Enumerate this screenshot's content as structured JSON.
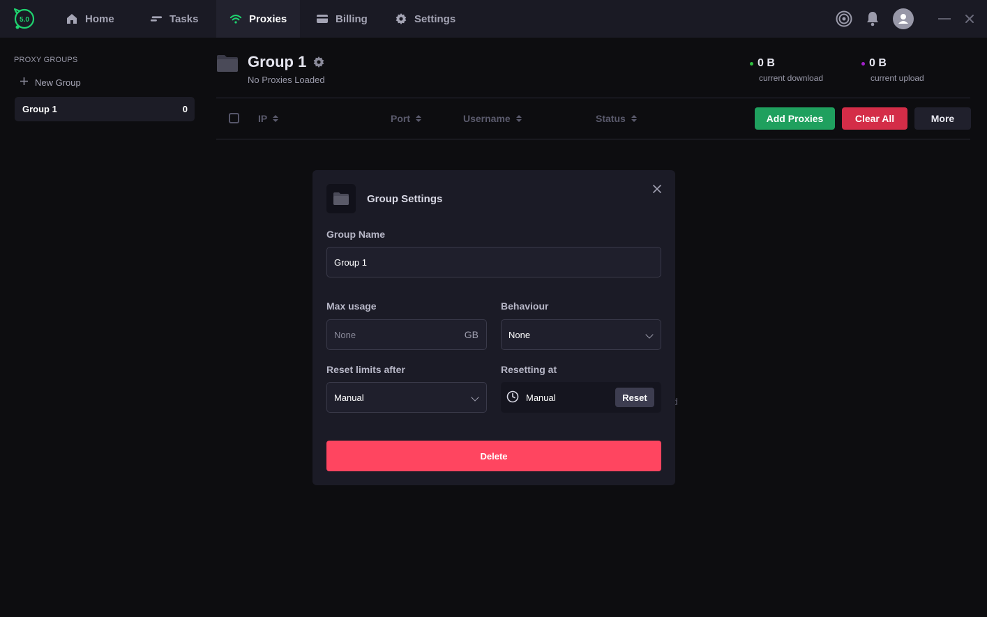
{
  "topbar": {
    "logo_text": "5.0",
    "tabs": [
      {
        "label": "Home",
        "icon": "home-icon"
      },
      {
        "label": "Tasks",
        "icon": "tasks-icon"
      },
      {
        "label": "Proxies",
        "icon": "wifi-icon",
        "active": true
      },
      {
        "label": "Billing",
        "icon": "card-icon"
      },
      {
        "label": "Settings",
        "icon": "gear-icon"
      }
    ],
    "accent": "#1fd36f"
  },
  "sidebar": {
    "title": "PROXY GROUPS",
    "new_group_label": "New Group",
    "groups": [
      {
        "name": "Group 1",
        "count": "0"
      }
    ]
  },
  "main": {
    "title": "Group 1",
    "subtitle": "No Proxies Loaded",
    "download": {
      "value": "0 B",
      "label": "current download",
      "dot_color": "#2fbf3f"
    },
    "upload": {
      "value": "0 B",
      "label": "current upload",
      "dot_color": "#a020c8"
    },
    "columns": [
      "IP",
      "Port",
      "Username",
      "Status"
    ],
    "buttons": {
      "add": "Add Proxies",
      "clear": "Clear All",
      "more": "More"
    },
    "partial_text": "d"
  },
  "modal": {
    "title": "Group Settings",
    "group_name_label": "Group Name",
    "group_name_value": "Group 1",
    "max_usage_label": "Max usage",
    "max_usage_placeholder": "None",
    "max_usage_unit": "GB",
    "behaviour_label": "Behaviour",
    "behaviour_value": "None",
    "reset_limits_label": "Reset limits after",
    "reset_limits_value": "Manual",
    "resetting_at_label": "Resetting at",
    "resetting_at_value": "Manual",
    "reset_button": "Reset",
    "delete_button": "Delete"
  },
  "colors": {
    "add_button": "#1fa05e",
    "clear_button": "#d42d48",
    "delete_button": "#ff4560"
  }
}
